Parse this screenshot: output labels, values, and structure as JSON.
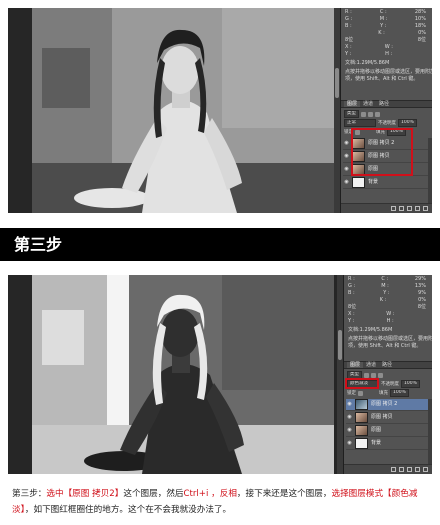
{
  "colors": {
    "accent_red": "#d0101a",
    "banner_bg": "#000000",
    "panel_bg": "#535353",
    "selected_layer": "#5f7aa5"
  },
  "screenshot1": {
    "info": {
      "rows": [
        [
          "R :",
          "C :",
          "28%"
        ],
        [
          "G :",
          "M :",
          "10%"
        ],
        [
          "B :",
          "Y :",
          "18%"
        ],
        [
          "",
          "K :",
          "0%"
        ],
        [
          "8位",
          "",
          "8位"
        ],
        [
          "X :",
          "W :",
          ""
        ],
        [
          "Y :",
          "H :",
          ""
        ]
      ],
      "doc_size": "文档:1.29M/5.86M",
      "hint_lines": [
        "点按并拖移以移动图层或选区，要用附加选",
        "项，使用 Shift、Alt 和 Ctrl 键。"
      ]
    },
    "tabs": [
      "图层",
      "通道",
      "路径"
    ],
    "filter": {
      "kind": "类型",
      "blend": "正常",
      "opacity_label": "不透明度",
      "opacity": "100%"
    },
    "lock": {
      "label": "锁定",
      "fill_label": "填充",
      "fill": "100%"
    },
    "layers": [
      {
        "name": "原图 拷贝 2",
        "selected": false
      },
      {
        "name": "原图 拷贝",
        "selected": false
      },
      {
        "name": "原图",
        "selected": false
      },
      {
        "name": "背景",
        "selected": false
      }
    ]
  },
  "step_title": "第三步",
  "screenshot2": {
    "info": {
      "rows": [
        [
          "R :",
          "C :",
          "29%"
        ],
        [
          "G :",
          "M :",
          "13%"
        ],
        [
          "B :",
          "Y :",
          "9%"
        ],
        [
          "",
          "K :",
          "0%"
        ],
        [
          "8位",
          "",
          "8位"
        ],
        [
          "X :",
          "W :",
          ""
        ],
        [
          "Y :",
          "H :",
          ""
        ]
      ],
      "doc_size": "文档:1.29M/5.86M",
      "hint_lines": [
        "点按并拖移以移动图层或选区，要用附加选",
        "项，使用 Shift、Alt 和 Ctrl 键。"
      ]
    },
    "tabs": [
      "图层",
      "通道",
      "路径"
    ],
    "filter": {
      "kind": "类型",
      "blend": "颜色减淡",
      "opacity_label": "不透明度",
      "opacity": "100%"
    },
    "lock": {
      "label": "锁定",
      "fill_label": "填充",
      "fill": "100%"
    },
    "layers": [
      {
        "name": "原图 拷贝 2",
        "selected": true
      },
      {
        "name": "原图 拷贝",
        "selected": false
      },
      {
        "name": "原图",
        "selected": false
      },
      {
        "name": "背景",
        "selected": false
      }
    ]
  },
  "caption": {
    "p1": "第三步：",
    "p2": "选中【原图 拷贝2】",
    "p3": "这个图层，然后",
    "p4": "Ctrl+i ，反相",
    "p5": "，接下来还是这个图层，",
    "p6": "选择图层模式【颜色减淡】",
    "p7": "，如下图红框圈住的地方。这个在不会我就没办法了。"
  }
}
